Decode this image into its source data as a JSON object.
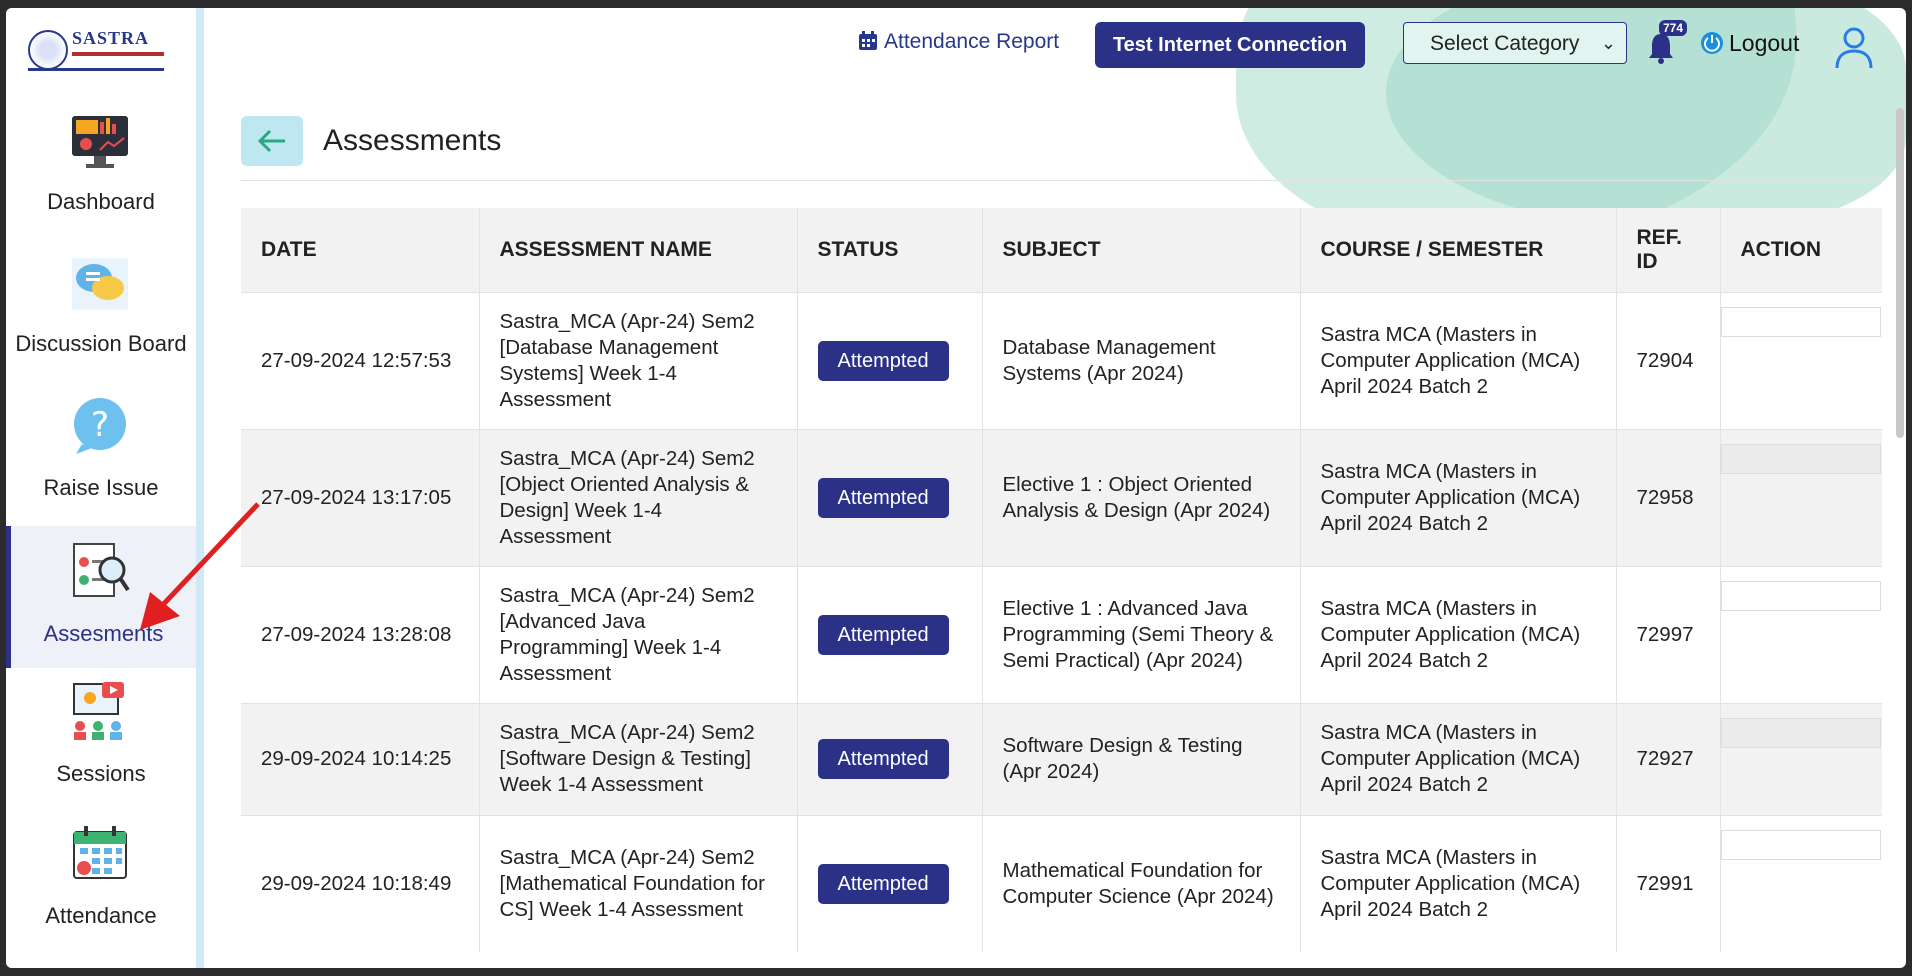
{
  "logo": {
    "name": "SASTRA"
  },
  "sidebar": {
    "items": [
      {
        "label": "Dashboard",
        "icon": "dashboard-icon",
        "active": false
      },
      {
        "label": "Discussion Board",
        "icon": "chat-bubbles-icon",
        "active": false
      },
      {
        "label": "Raise Issue",
        "icon": "question-icon",
        "active": false
      },
      {
        "label": "Assesments",
        "icon": "assessment-icon",
        "active": true
      },
      {
        "label": "Sessions",
        "icon": "sessions-icon",
        "active": false
      },
      {
        "label": "Attendance",
        "icon": "calendar-icon",
        "active": false
      }
    ]
  },
  "header": {
    "attendance_report": "Attendance Report",
    "test_connection": "Test Internet Connection",
    "select_category": "Select Category",
    "notification_count": "774",
    "logout": "Logout"
  },
  "page": {
    "title": "Assessments"
  },
  "table": {
    "headers": [
      "DATE",
      "ASSESSMENT NAME",
      "STATUS",
      "SUBJECT",
      "COURSE / SEMESTER",
      "REF. ID",
      "ACTION"
    ],
    "rows": [
      {
        "date": "27-09-2024 12:57:53",
        "name": "Sastra_MCA (Apr-24) Sem2 [Database Management Systems] Week 1-4 Assessment",
        "status": "Attempted",
        "subject": "Database Management Systems (Apr 2024)",
        "course": "Sastra MCA (Masters in Computer Application (MCA) April 2024 Batch 2",
        "ref": "72904"
      },
      {
        "date": "27-09-2024 13:17:05",
        "name": "Sastra_MCA (Apr-24) Sem2 [Object Oriented Analysis & Design] Week 1-4 Assessment",
        "status": "Attempted",
        "subject": "Elective 1 : Object Oriented Analysis & Design (Apr 2024)",
        "course": "Sastra MCA (Masters in Computer Application (MCA) April 2024 Batch 2",
        "ref": "72958"
      },
      {
        "date": "27-09-2024 13:28:08",
        "name": "Sastra_MCA (Apr-24) Sem2 [Advanced Java Programming] Week 1-4 Assessment",
        "status": "Attempted",
        "subject": "Elective 1 : Advanced Java Programming (Semi Theory & Semi Practical) (Apr 2024)",
        "course": "Sastra MCA (Masters in Computer Application (MCA) April 2024 Batch 2",
        "ref": "72997"
      },
      {
        "date": "29-09-2024 10:14:25",
        "name": "Sastra_MCA (Apr-24) Sem2 [Software Design & Testing] Week 1-4 Assessment",
        "status": "Attempted",
        "subject": "Software Design & Testing (Apr 2024)",
        "course": "Sastra MCA (Masters in Computer Application (MCA) April 2024 Batch 2",
        "ref": "72927"
      },
      {
        "date": "29-09-2024 10:18:49",
        "name": "Sastra_MCA (Apr-24) Sem2 [Mathematical Foundation for CS] Week 1-4 Assessment",
        "status": "Attempted",
        "subject": "Mathematical Foundation for Computer Science (Apr 2024)",
        "course": "Sastra MCA (Masters in Computer Application (MCA) April 2024 Batch 2",
        "ref": "72991"
      }
    ]
  },
  "colors": {
    "primary": "#2a3187",
    "accent_green": "#9fd9c7",
    "back_button": "#bfe7f2",
    "annotation_arrow": "#e02020"
  }
}
